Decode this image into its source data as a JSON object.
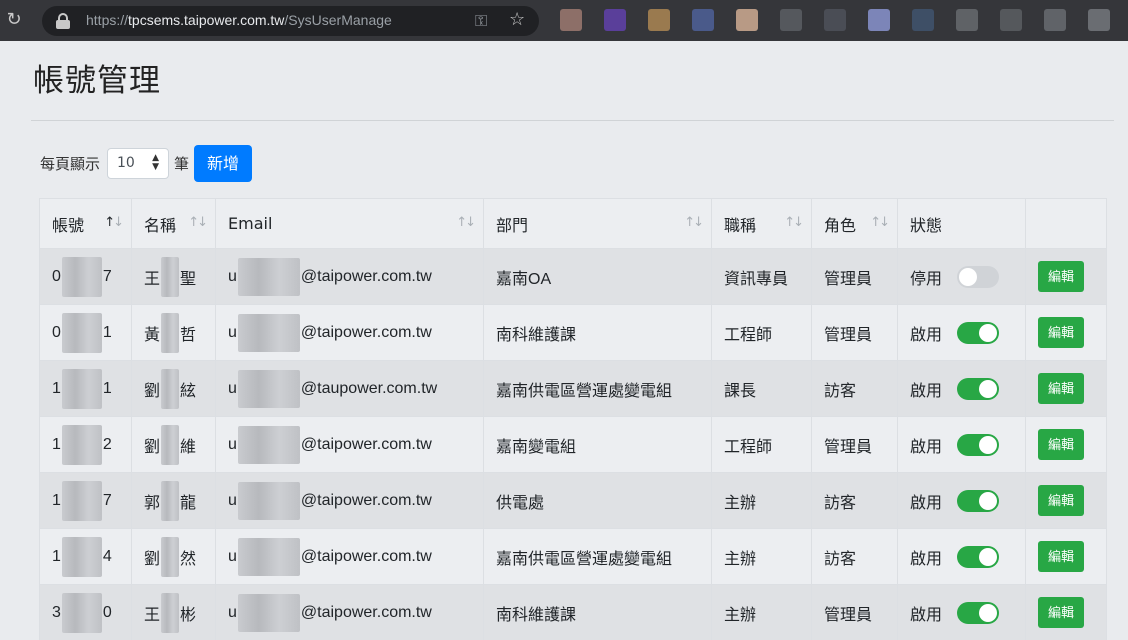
{
  "browser": {
    "url_scheme": "https://",
    "url_host": "tpcsems.taipower.com.tw",
    "url_path": "/SysUserManage"
  },
  "page": {
    "title": "帳號管理",
    "per_page_label": "每頁顯示",
    "per_page_value": "10",
    "per_page_unit": "筆",
    "add_button": "新增"
  },
  "table": {
    "headers": [
      "帳號",
      "名稱",
      "Email",
      "部門",
      "職稱",
      "角色",
      "狀態"
    ],
    "edit_label": "編輯",
    "rows": [
      {
        "account_start": "0",
        "account_end": "7",
        "name_start": "王",
        "name_end": "聖",
        "email_start": "u",
        "email_domain": "@taipower.com.tw",
        "dept": "嘉南OA",
        "title": "資訊專員",
        "role": "管理員",
        "status": "停用",
        "enabled": false
      },
      {
        "account_start": "0",
        "account_end": "1",
        "name_start": "黃",
        "name_end": "哲",
        "email_start": "u",
        "email_domain": "@taipower.com.tw",
        "dept": "南科維護課",
        "title": "工程師",
        "role": "管理員",
        "status": "啟用",
        "enabled": true
      },
      {
        "account_start": "1",
        "account_end": "1",
        "name_start": "劉",
        "name_end": "絃",
        "email_start": "u",
        "email_domain": "@taupower.com.tw",
        "dept": "嘉南供電區營運處變電組",
        "title": "課長",
        "role": "訪客",
        "status": "啟用",
        "enabled": true
      },
      {
        "account_start": "1",
        "account_end": "2",
        "name_start": "劉",
        "name_end": "維",
        "email_start": "u",
        "email_domain": "@taipower.com.tw",
        "dept": "嘉南變電組",
        "title": "工程師",
        "role": "管理員",
        "status": "啟用",
        "enabled": true
      },
      {
        "account_start": "1",
        "account_end": "7",
        "name_start": "郭",
        "name_end": "龍",
        "email_start": "u",
        "email_domain": "@taipower.com.tw",
        "dept": "供電處",
        "title": "主辦",
        "role": "訪客",
        "status": "啟用",
        "enabled": true
      },
      {
        "account_start": "1",
        "account_end": "4",
        "name_start": "劉",
        "name_end": "然",
        "email_start": "u",
        "email_domain": "@taipower.com.tw",
        "dept": "嘉南供電區營運處變電組",
        "title": "主辦",
        "role": "訪客",
        "status": "啟用",
        "enabled": true
      },
      {
        "account_start": "3",
        "account_end": "0",
        "name_start": "王",
        "name_end": "彬",
        "email_start": "u",
        "email_domain": "@taipower.com.tw",
        "dept": "南科維護課",
        "title": "主辦",
        "role": "管理員",
        "status": "啟用",
        "enabled": true
      }
    ]
  }
}
